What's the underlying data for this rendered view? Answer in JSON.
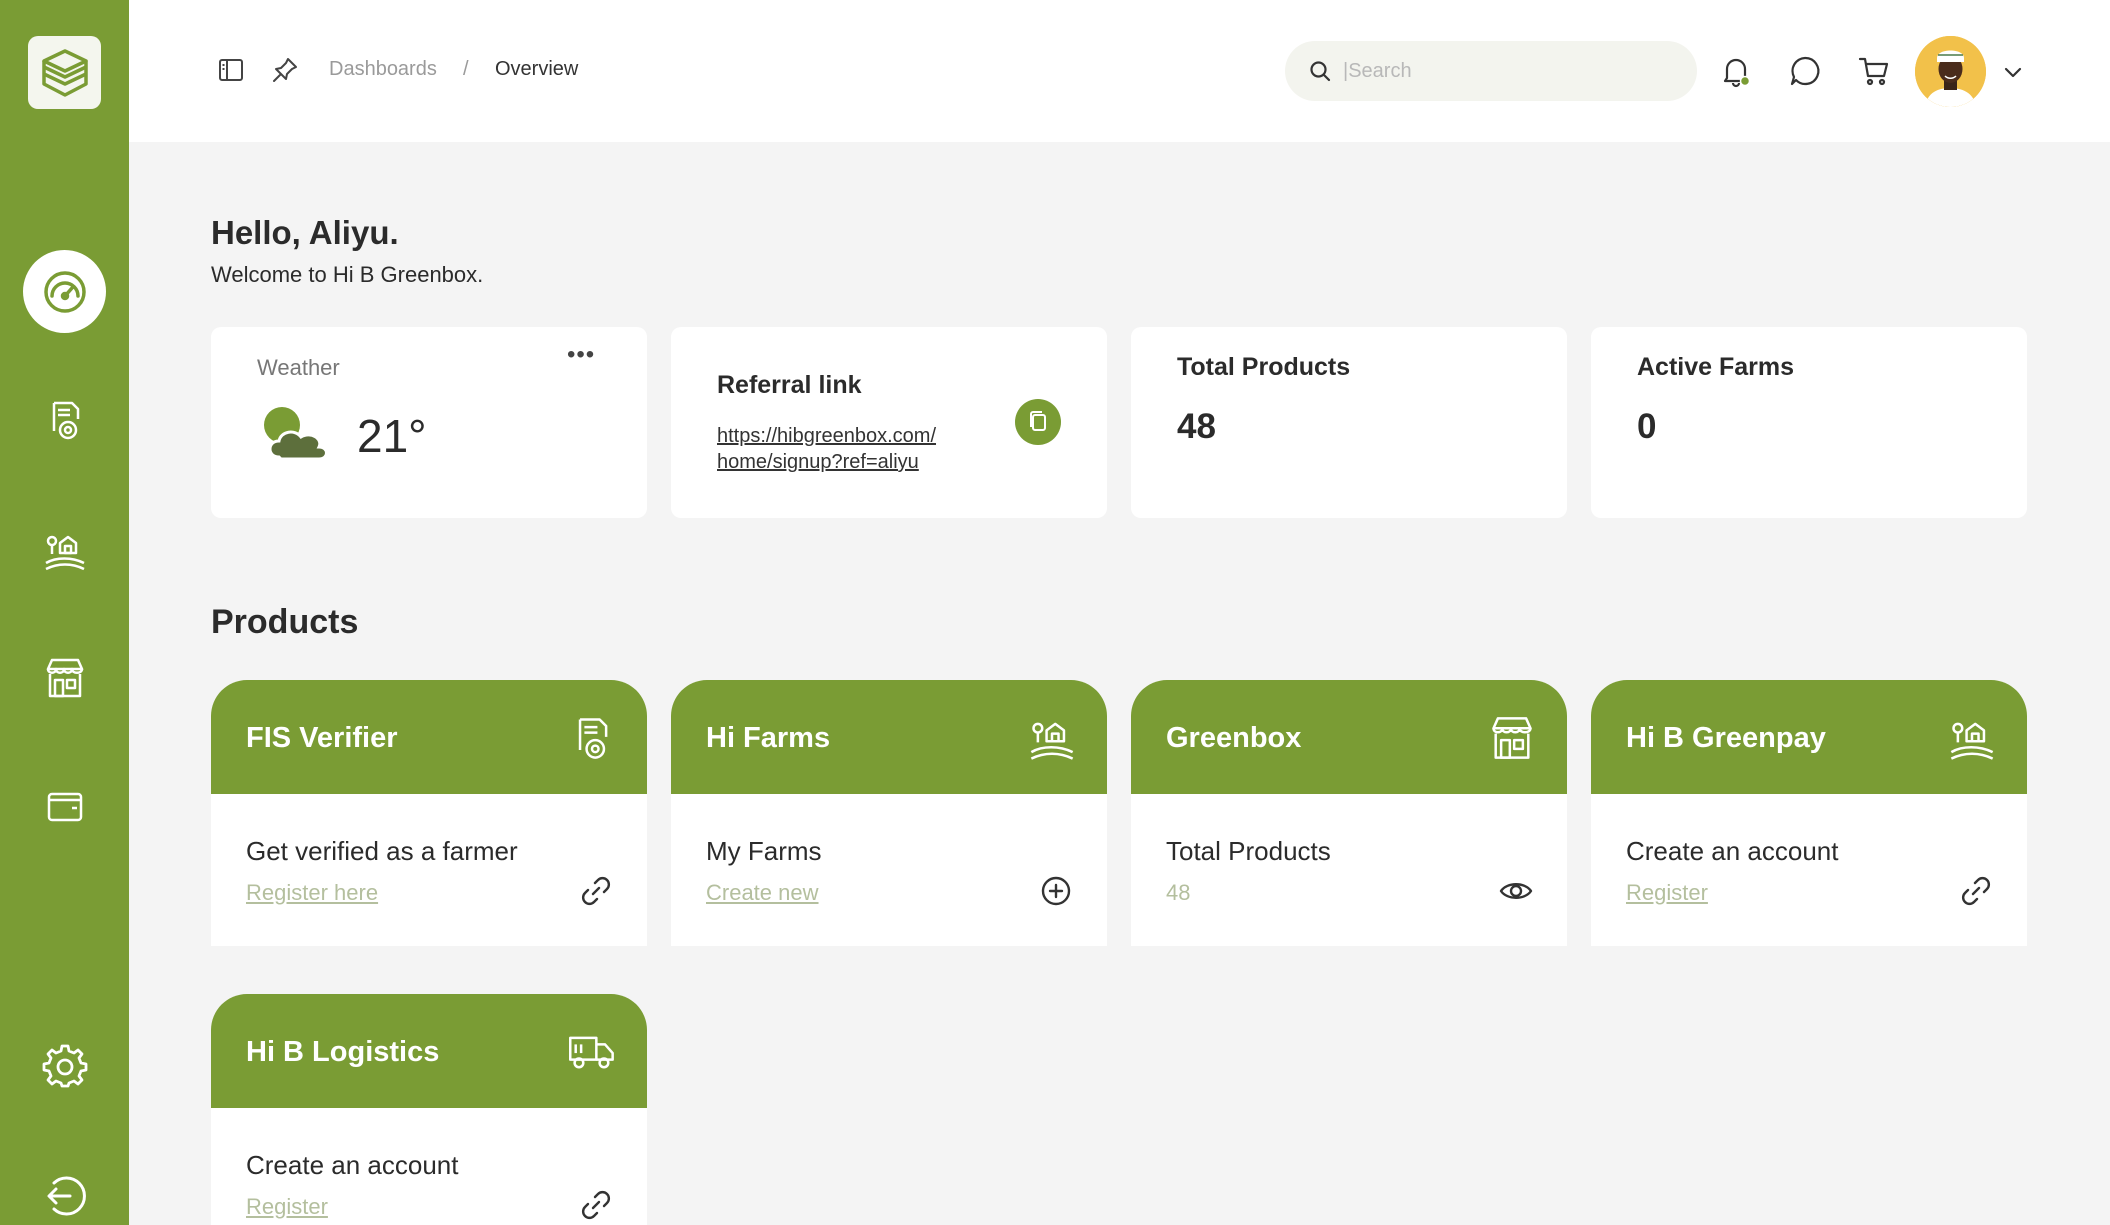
{
  "app": {
    "title": "Hi B Greenbox"
  },
  "colors": {
    "brand_green": "#7a9c34",
    "dark_green": "#5d6f3c",
    "background": "#f4f4f4",
    "muted_link": "#b4bf9e"
  },
  "sidebar": {
    "logo_icon": "cube-logo-icon",
    "items": [
      {
        "name": "dashboard",
        "icon": "speedometer-icon",
        "active": true
      },
      {
        "name": "fis-verifier",
        "icon": "document-gear-icon",
        "active": false
      },
      {
        "name": "farms",
        "icon": "farm-icon",
        "active": false
      },
      {
        "name": "store",
        "icon": "store-icon",
        "active": false
      },
      {
        "name": "wallet",
        "icon": "wallet-icon",
        "active": false
      },
      {
        "name": "settings",
        "icon": "gear-icon",
        "active": false
      },
      {
        "name": "logout",
        "icon": "logout-icon",
        "active": false
      }
    ]
  },
  "header": {
    "breadcrumb": {
      "parent": "Dashboards",
      "separator": "/",
      "current": "Overview"
    },
    "search": {
      "placeholder": "|Search",
      "value": ""
    }
  },
  "greeting": {
    "title": "Hello, Aliyu.",
    "subtitle": "Welcome to Hi B Greenbox."
  },
  "cards": {
    "weather": {
      "label": "Weather",
      "temperature": "21°",
      "menu": "•••"
    },
    "referral": {
      "label": "Referral link",
      "url_line1": "https://hibgreenbox.com/",
      "url_line2": "home/signup?ref=aliyu"
    },
    "total_products": {
      "label": "Total Products",
      "value": "48"
    },
    "active_farms": {
      "label": "Active Farms",
      "value": "0"
    }
  },
  "products_section": {
    "title": "Products"
  },
  "products": [
    {
      "title": "FIS Verifier",
      "desc": "Get verified as a farmer",
      "link": "Register here",
      "icon": "document-gear-icon",
      "action_icon": "link-icon"
    },
    {
      "title": "Hi Farms",
      "desc": "My Farms",
      "link": "Create new",
      "icon": "farm-icon",
      "action_icon": "plus-circle-icon"
    },
    {
      "title": "Greenbox",
      "desc": "Total Products",
      "value": "48",
      "icon": "store-icon",
      "action_icon": "eye-icon"
    },
    {
      "title": "Hi B Greenpay",
      "desc": "Create an account",
      "link": "Register",
      "icon": "farm-icon",
      "action_icon": "link-icon"
    },
    {
      "title": "Hi B Logistics",
      "desc": "Create an account",
      "link": "Register",
      "icon": "truck-icon",
      "action_icon": "link-icon"
    }
  ]
}
